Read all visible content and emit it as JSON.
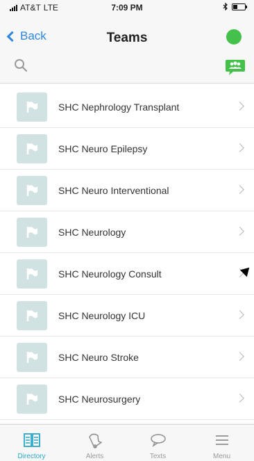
{
  "status": {
    "carrier": "AT&T",
    "network": "LTE",
    "time": "7:09 PM"
  },
  "nav": {
    "back_label": "Back",
    "title": "Teams"
  },
  "colors": {
    "accent_blue": "#2f86de",
    "presence_green": "#43c14a",
    "tab_active": "#2aa6c8",
    "avatar_bg": "#d1e2e2"
  },
  "teams": [
    {
      "name": "SHC Nephrology Transplant"
    },
    {
      "name": "SHC Neuro Epilepsy"
    },
    {
      "name": "SHC Neuro Interventional"
    },
    {
      "name": "SHC Neurology"
    },
    {
      "name": "SHC Neurology Consult"
    },
    {
      "name": "SHC Neurology ICU"
    },
    {
      "name": "SHC Neuro Stroke"
    },
    {
      "name": "SHC Neurosurgery"
    }
  ],
  "tabs": [
    {
      "label": "Directory",
      "icon": "directory-icon",
      "active": true
    },
    {
      "label": "Alerts",
      "icon": "bell-icon",
      "active": false
    },
    {
      "label": "Texts",
      "icon": "speech-bubble-icon",
      "active": false
    },
    {
      "label": "Menu",
      "icon": "hamburger-menu-icon",
      "active": false
    }
  ]
}
